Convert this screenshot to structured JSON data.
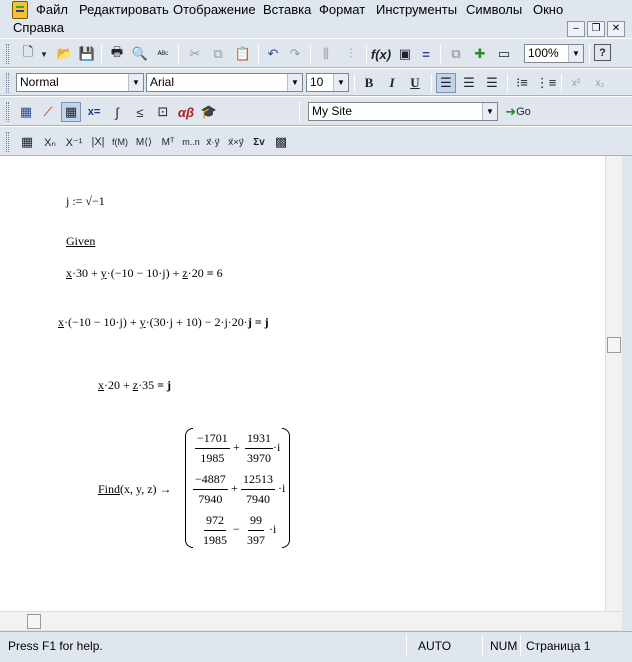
{
  "menubar": {
    "items": [
      {
        "label": "Файл"
      },
      {
        "label": "Редактировать"
      },
      {
        "label": "Отображение"
      },
      {
        "label": "Вставка"
      },
      {
        "label": "Формат"
      },
      {
        "label": "Инструменты"
      },
      {
        "label": "Символы"
      },
      {
        "label": "Окно"
      },
      {
        "label": "Справка"
      }
    ]
  },
  "formatting": {
    "style": "Normal",
    "font": "Arial",
    "size": "10"
  },
  "standard": {
    "zoom": "100%"
  },
  "resources": {
    "site": "My Site",
    "go_label": "Go"
  },
  "worksheet": {
    "eq1": "j := √−1",
    "given": "Given",
    "find": "Find",
    "find_args": "(x, y, z) →",
    "matrix": [
      {
        "a_num": "−1701",
        "a_den": "1985",
        "op": "+",
        "b_num": "1931",
        "b_den": "3970",
        "unit": "·i"
      },
      {
        "a_num": "−4887",
        "a_den": "7940",
        "op": "+",
        "b_num": "12513",
        "b_den": "7940",
        "unit": "·i"
      },
      {
        "a_num": "972",
        "a_den": "1985",
        "op": "−",
        "b_num": "99",
        "b_den": "397",
        "unit": "·i"
      }
    ]
  },
  "status": {
    "help": "Press F1 for help.",
    "auto": "AUTO",
    "num": "NUM",
    "page": "Страница 1"
  },
  "icons": [
    "app-icon",
    "new-icon",
    "open-icon",
    "save-icon",
    "print-icon",
    "print-preview-icon",
    "spell-check-icon",
    "cut-icon",
    "copy-icon",
    "paste-icon",
    "undo-icon",
    "redo-icon",
    "align-icon",
    "function-icon",
    "unit-icon",
    "equals-icon",
    "component-icon",
    "resource-icon",
    "window-icon",
    "help-icon",
    "bold-icon",
    "italic-icon",
    "underline-icon",
    "align-left-icon",
    "align-center-icon",
    "align-right-icon",
    "bullets-icon",
    "numbering-icon",
    "superscript-icon",
    "subscript-icon",
    "calculator-icon",
    "graph-icon",
    "matrix-icon",
    "evaluation-icon",
    "calculus-icon",
    "boolean-icon",
    "programming-icon",
    "greek-icon",
    "symbolic-icon",
    "go-icon"
  ]
}
